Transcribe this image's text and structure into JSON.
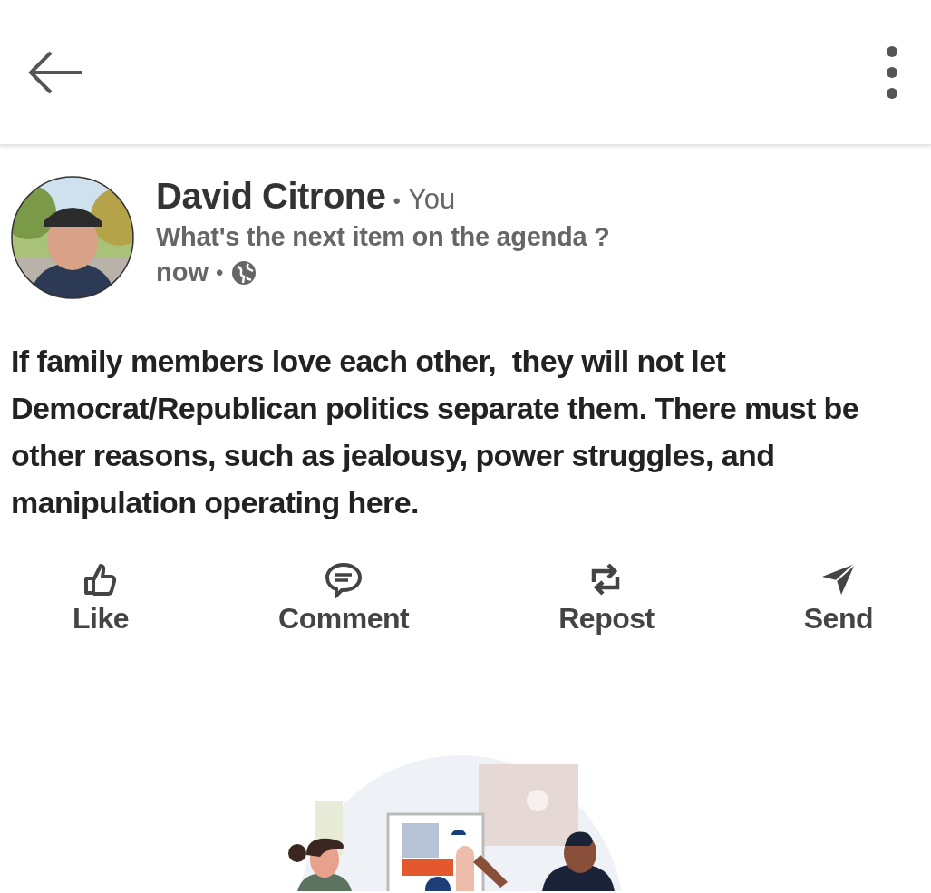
{
  "post": {
    "author": "David Citrone",
    "author_separator": "•",
    "badge": "You",
    "headline": "What's the next item on the agenda ?",
    "time": "now",
    "time_separator": "•",
    "text": "If family members love each other,  they will not let Democrat/Republican politics separate them. There must be other reasons, such as jealousy, power struggles, and manipulation operating here."
  },
  "actions": [
    {
      "label": "Like",
      "kind": "like"
    },
    {
      "label": "Comment",
      "kind": "comment"
    },
    {
      "label": "Repost",
      "kind": "repost"
    },
    {
      "label": "Send",
      "kind": "send"
    }
  ]
}
